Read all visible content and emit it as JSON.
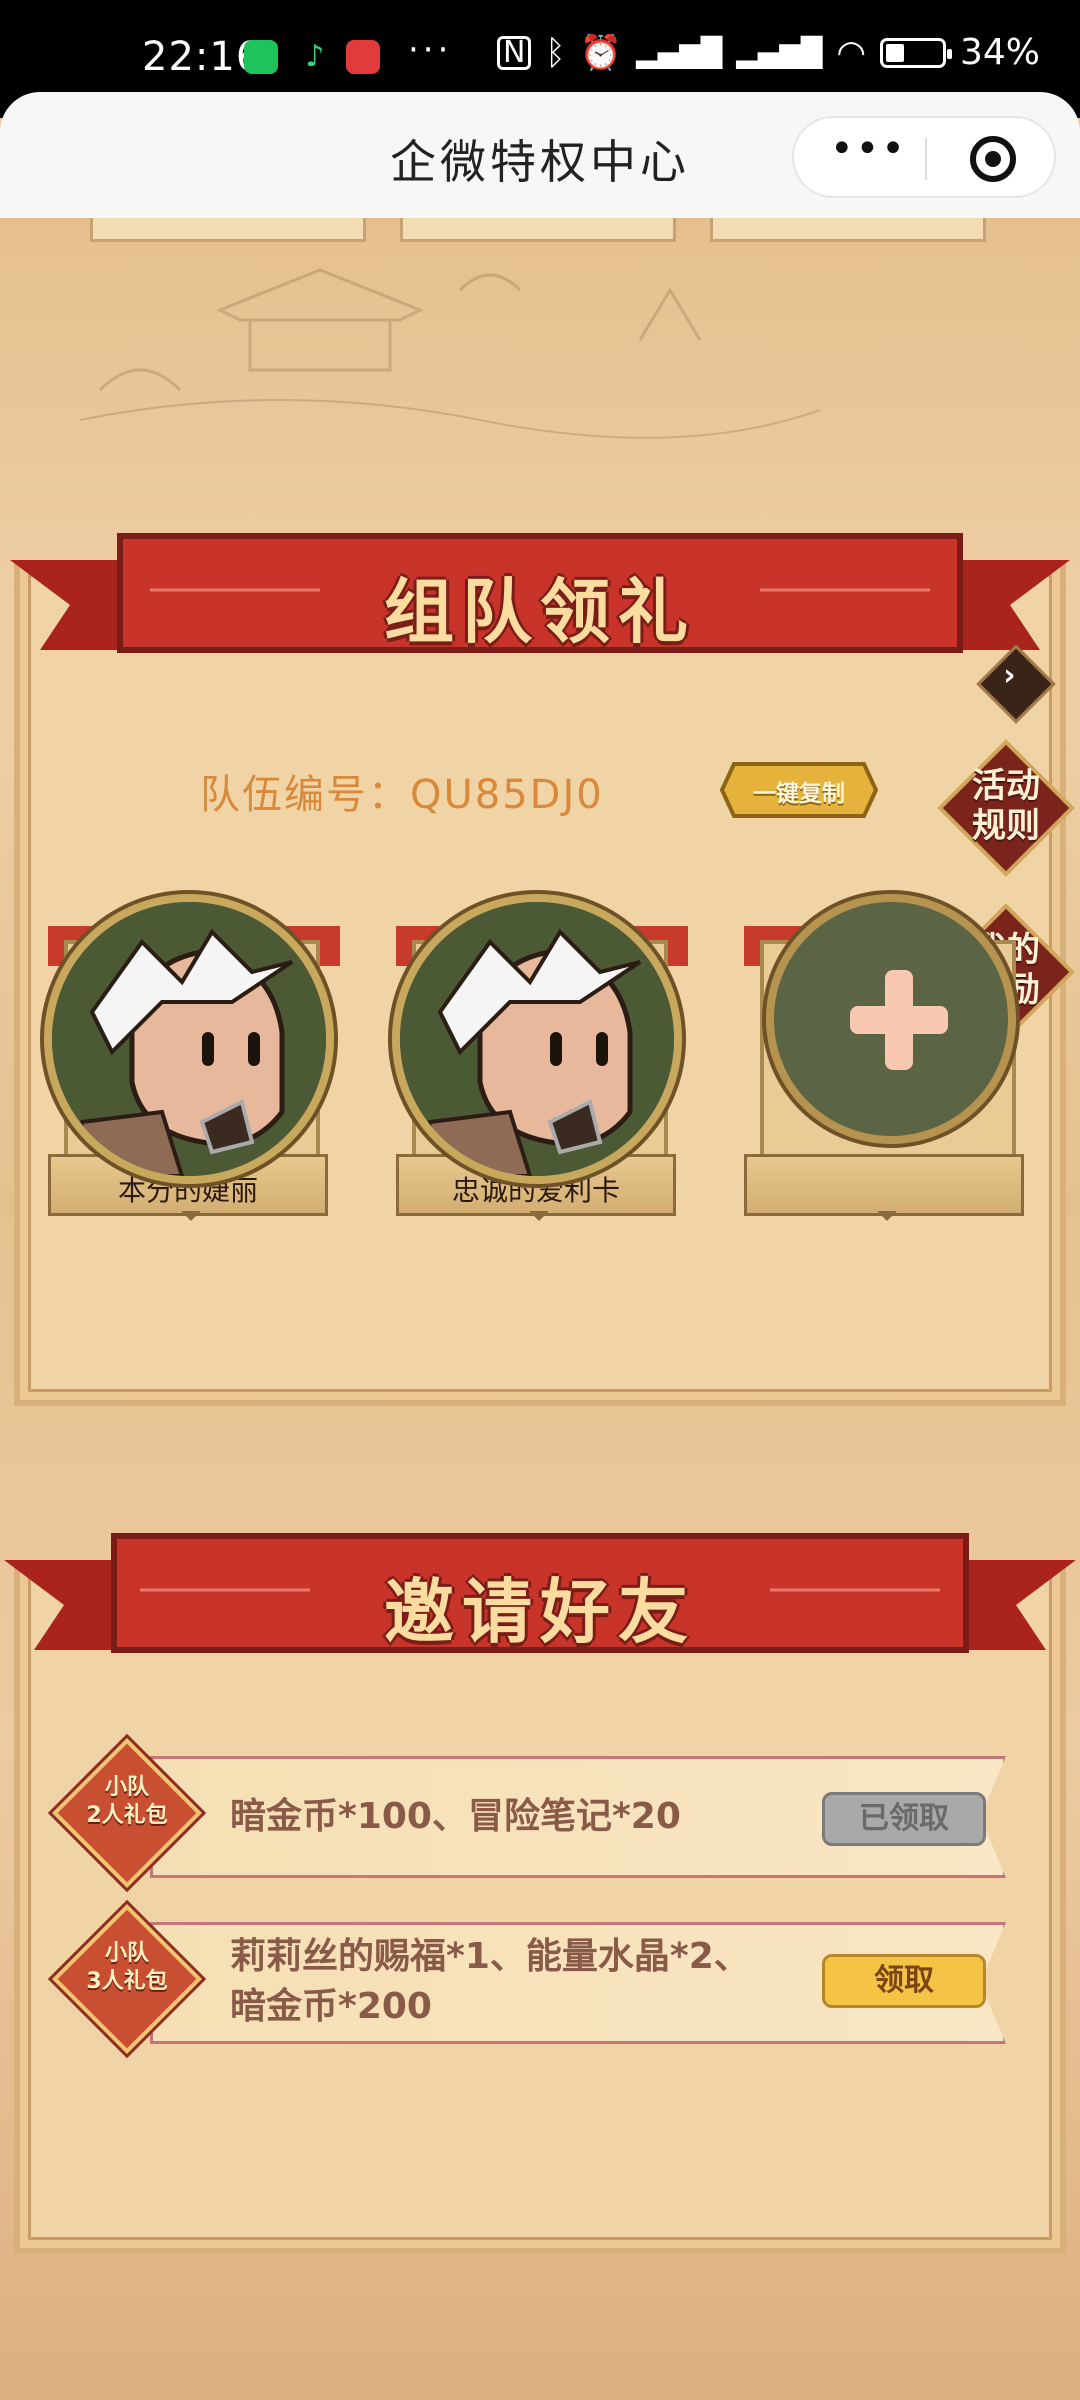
{
  "status_bar": {
    "time": "22:16",
    "dots": "···",
    "battery_text": "34%",
    "battery_level": 0.34,
    "icons": [
      "wechat-icon",
      "music-icon",
      "app-icon",
      "nfc-icon",
      "bluetooth-icon",
      "alarm-icon",
      "hd-signal-icon",
      "hd-signal-icon",
      "wifi-icon",
      "battery-icon"
    ]
  },
  "title_bar": {
    "title": "企微特权中心",
    "more_label": "•••"
  },
  "team_panel": {
    "banner": "组队领礼",
    "team_label": "队伍编号：",
    "team_code": "QU85DJ0",
    "copy_button": "一键复制",
    "rules_button": "活动\n规则",
    "rewards_button": "我的\n奖励",
    "members": [
      {
        "name": "本分的婕丽"
      },
      {
        "name": "忠诚的爱利卡"
      },
      {
        "name": ""
      }
    ]
  },
  "invite_panel": {
    "banner": "邀请好友",
    "rewards": [
      {
        "badge": "小队\n2人礼包",
        "desc": "暗金币*100、冒险笔记*20",
        "button": "已领取",
        "state": "claimed"
      },
      {
        "badge": "小队\n3人礼包",
        "desc": "莉莉丝的赐福*1、能量水晶*2、\n暗金币*200",
        "button": "领取",
        "state": "available"
      }
    ]
  },
  "colors": {
    "banner_red": "#c8332a",
    "banner_text": "#fbdca0",
    "team_text": "#d88a3a",
    "claim_yellow": "#f6c445",
    "claimed_gray": "#a9a9a9"
  }
}
